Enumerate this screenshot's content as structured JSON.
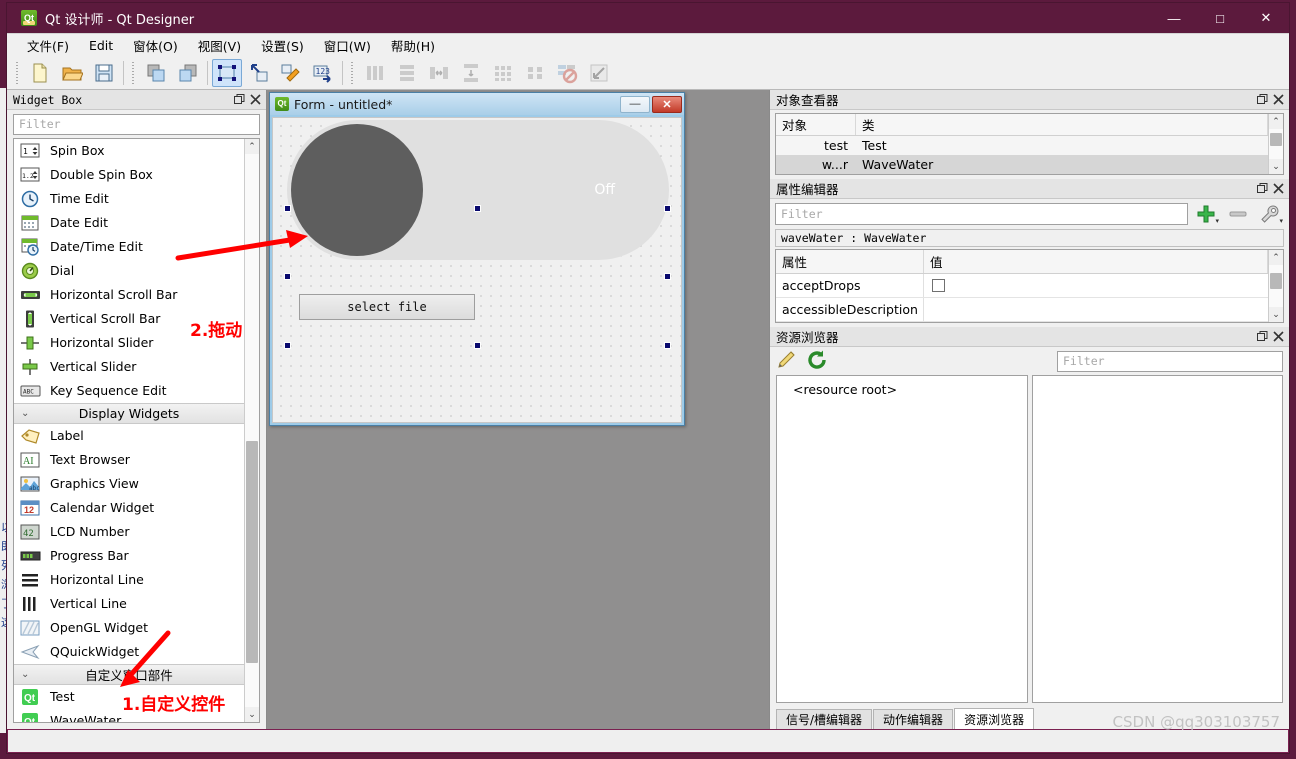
{
  "window": {
    "title": "Qt 设计师 - Qt Designer",
    "logo_text": "Qt",
    "controls": {
      "minimize": "—",
      "maximize": "□",
      "close": "✕"
    }
  },
  "menubar": {
    "items": [
      {
        "label": "文件(F)"
      },
      {
        "label": "Edit"
      },
      {
        "label": "窗体(O)"
      },
      {
        "label": "视图(V)"
      },
      {
        "label": "设置(S)"
      },
      {
        "label": "窗口(W)"
      },
      {
        "label": "帮助(H)"
      }
    ]
  },
  "toolbar": {
    "groups": [
      {
        "buttons": [
          {
            "icon": "new-file-icon",
            "enabled": true,
            "active": false
          },
          {
            "icon": "open-folder-icon",
            "enabled": true,
            "active": false
          },
          {
            "icon": "save-icon",
            "enabled": true,
            "active": false
          }
        ]
      },
      {
        "buttons": [
          {
            "icon": "undo-icon",
            "enabled": true,
            "active": false
          },
          {
            "icon": "redo-icon",
            "enabled": true,
            "active": false
          }
        ]
      },
      {
        "buttons": [
          {
            "icon": "edit-widgets-icon",
            "enabled": true,
            "active": true
          },
          {
            "icon": "edit-signals-slots-icon",
            "enabled": true,
            "active": false
          },
          {
            "icon": "edit-buddies-icon",
            "enabled": true,
            "active": false
          },
          {
            "icon": "edit-tab-order-icon",
            "enabled": true,
            "active": false
          }
        ]
      },
      {
        "buttons": [
          {
            "icon": "layout-horizontally-icon",
            "enabled": false,
            "active": false
          },
          {
            "icon": "layout-vertically-icon",
            "enabled": false,
            "active": false
          },
          {
            "icon": "layout-splitter-horizontal-icon",
            "enabled": false,
            "active": false
          },
          {
            "icon": "layout-splitter-vertical-icon",
            "enabled": false,
            "active": false
          },
          {
            "icon": "layout-grid-icon",
            "enabled": false,
            "active": false
          },
          {
            "icon": "layout-form-icon",
            "enabled": false,
            "active": false
          },
          {
            "icon": "break-layout-icon",
            "enabled": false,
            "active": false
          },
          {
            "icon": "adjust-size-icon",
            "enabled": false,
            "active": false
          }
        ]
      }
    ]
  },
  "widget_box": {
    "title": "Widget Box",
    "filter_placeholder": "Filter",
    "restore_icon": "restore-icon",
    "close_icon": "close-icon",
    "items": [
      {
        "type": "widget",
        "label": "Spin Box",
        "icon": "spin-box-icon"
      },
      {
        "type": "widget",
        "label": "Double Spin Box",
        "icon": "double-spin-box-icon"
      },
      {
        "type": "widget",
        "label": "Time Edit",
        "icon": "time-edit-icon"
      },
      {
        "type": "widget",
        "label": "Date Edit",
        "icon": "date-edit-icon"
      },
      {
        "type": "widget",
        "label": "Date/Time Edit",
        "icon": "date-time-edit-icon"
      },
      {
        "type": "widget",
        "label": "Dial",
        "icon": "dial-icon"
      },
      {
        "type": "widget",
        "label": "Horizontal Scroll Bar",
        "icon": "horizontal-scroll-bar-icon"
      },
      {
        "type": "widget",
        "label": "Vertical Scroll Bar",
        "icon": "vertical-scroll-bar-icon"
      },
      {
        "type": "widget",
        "label": "Horizontal Slider",
        "icon": "horizontal-slider-icon"
      },
      {
        "type": "widget",
        "label": "Vertical Slider",
        "icon": "vertical-slider-icon"
      },
      {
        "type": "widget",
        "label": "Key Sequence Edit",
        "icon": "key-sequence-edit-icon"
      },
      {
        "type": "group",
        "label": "Display Widgets",
        "icon": "chevron-down-icon"
      },
      {
        "type": "widget",
        "label": "Label",
        "icon": "label-icon"
      },
      {
        "type": "widget",
        "label": "Text Browser",
        "icon": "text-browser-icon"
      },
      {
        "type": "widget",
        "label": "Graphics View",
        "icon": "graphics-view-icon"
      },
      {
        "type": "widget",
        "label": "Calendar Widget",
        "icon": "calendar-widget-icon"
      },
      {
        "type": "widget",
        "label": "LCD Number",
        "icon": "lcd-number-icon"
      },
      {
        "type": "widget",
        "label": "Progress Bar",
        "icon": "progress-bar-icon"
      },
      {
        "type": "widget",
        "label": "Horizontal Line",
        "icon": "horizontal-line-icon"
      },
      {
        "type": "widget",
        "label": "Vertical Line",
        "icon": "vertical-line-icon"
      },
      {
        "type": "widget",
        "label": "OpenGL Widget",
        "icon": "opengl-widget-icon"
      },
      {
        "type": "widget",
        "label": "QQuickWidget",
        "icon": "qquickwidget-icon"
      },
      {
        "type": "group",
        "label": "自定义窗口部件",
        "icon": "chevron-down-icon"
      },
      {
        "type": "custom",
        "label": "Test",
        "icon": "qt-custom-widget-icon"
      },
      {
        "type": "custom",
        "label": "WaveWater",
        "icon": "qt-custom-widget-icon"
      }
    ]
  },
  "form": {
    "title": "Form - untitled*",
    "logo_text": "Qt",
    "minimize_label": "—",
    "close_label": "✕",
    "wave_water": {
      "state_label": "Off"
    },
    "select_file_button": {
      "label": "select file"
    }
  },
  "object_inspector": {
    "title": "对象查看器",
    "restore_icon": "restore-icon",
    "close_icon": "close-icon",
    "columns": [
      "对象",
      "类"
    ],
    "rows": [
      {
        "object": "test",
        "class": "Test",
        "selected": false
      },
      {
        "object": "w...r",
        "class": "WaveWater",
        "selected": true
      }
    ]
  },
  "property_editor": {
    "title": "属性编辑器",
    "restore_icon": "restore-icon",
    "close_icon": "close-icon",
    "filter_placeholder": "Filter",
    "buttons": [
      {
        "icon": "add-icon",
        "caret": "▾"
      },
      {
        "icon": "remove-icon",
        "caret": ""
      },
      {
        "icon": "configure-wrench-icon",
        "caret": "▾"
      }
    ],
    "object_class": "waveWater : WaveWater",
    "columns": [
      "属性",
      "值"
    ],
    "rows": [
      {
        "name": "acceptDrops",
        "value": "",
        "control": "checkbox",
        "checked": false
      },
      {
        "name": "accessibleDescription",
        "value": "",
        "control": "text"
      }
    ]
  },
  "resource_browser": {
    "title": "资源浏览器",
    "restore_icon": "restore-icon",
    "close_icon": "close-icon",
    "edit_icon": "pencil-edit-icon",
    "reload_icon": "reload-refresh-icon",
    "filter_placeholder": "Filter",
    "root_label": "<resource root>"
  },
  "bottom_tabs": [
    {
      "label": "信号/槽编辑器",
      "active": false
    },
    {
      "label": "动作编辑器",
      "active": false
    },
    {
      "label": "资源浏览器",
      "active": true
    }
  ],
  "annotations": [
    {
      "id": "annot-1",
      "text": "1.自定义控件",
      "color": "#ff0000",
      "font_size": 17
    },
    {
      "id": "annot-2",
      "text": "2.拖动",
      "color": "#ff0000",
      "font_size": 17
    }
  ],
  "background_window": {
    "vertical_text": "以即列浏了这"
  },
  "watermark": {
    "text": "CSDN @qq303103757"
  },
  "colors": {
    "title_bar": "#5C1A3D",
    "annotation_red": "#ff0000",
    "knob_gray": "#5e5e5e",
    "track_gray": "#e0e0e0",
    "selection_handle": "#0a0a6e"
  }
}
